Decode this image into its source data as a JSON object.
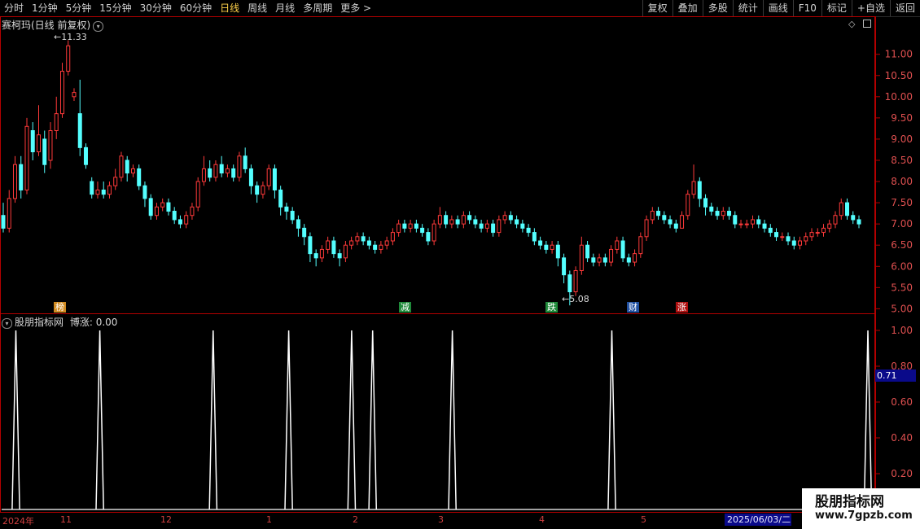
{
  "toolbar": {
    "left": [
      "分时",
      "1分钟",
      "5分钟",
      "15分钟",
      "30分钟",
      "60分钟",
      "日线",
      "周线",
      "月线",
      "多周期",
      "更多 >"
    ],
    "active_index": 6,
    "right": [
      "复权",
      "叠加",
      "多股",
      "统计",
      "画线",
      "F10",
      "标记",
      "+自选",
      "返回"
    ]
  },
  "main_panel": {
    "title": "赛柯玛(日线 前复权)",
    "high_label": "11.33",
    "low_label": "5.08",
    "markers": [
      {
        "text": "榜",
        "color": "#d08a20"
      },
      {
        "text": "减",
        "color": "#1f8a3a"
      },
      {
        "text": "跌",
        "color": "#1f8a3a"
      },
      {
        "text": "财",
        "color": "#2050a0"
      },
      {
        "text": "涨",
        "color": "#b01010"
      }
    ]
  },
  "indicator_panel": {
    "title": "股朋指标网",
    "value_label": "博涨: 0.00",
    "current_value": "0.71"
  },
  "x_axis": {
    "labels": [
      "2024年",
      "11",
      "12",
      "1",
      "2",
      "3",
      "4",
      "5"
    ],
    "current_date": "2025/06/03/二"
  },
  "watermark": {
    "line1": "股朋指标网",
    "line2": "www.7gpzb.com"
  },
  "colors": {
    "up": "#ff3a3a",
    "down": "#54ffff",
    "signal": "#ffffff",
    "axis": "#b40000"
  },
  "chart_data": {
    "type": "candlestick",
    "y_axis_main": {
      "ticks": [
        "11.00",
        "10.50",
        "10.00",
        "9.50",
        "9.00",
        "8.50",
        "8.00",
        "7.50",
        "7.00",
        "6.50",
        "6.00",
        "5.50",
        "5.00"
      ],
      "ylim": [
        4.95,
        11.8
      ]
    },
    "y_axis_indicator": {
      "ticks": [
        "1.00",
        "0.80",
        "0.60",
        "0.40",
        "0.20"
      ],
      "ylim": [
        0,
        1.05
      ]
    },
    "candles": [
      [
        7.2,
        6.9,
        7.5,
        6.8
      ],
      [
        6.9,
        7.6,
        7.8,
        6.8
      ],
      [
        7.6,
        8.4,
        8.6,
        7.5
      ],
      [
        8.4,
        7.8,
        8.6,
        7.6
      ],
      [
        7.8,
        9.3,
        9.5,
        7.7
      ],
      [
        9.2,
        8.7,
        9.4,
        8.5
      ],
      [
        8.7,
        9.1,
        9.8,
        8.6
      ],
      [
        9.0,
        8.4,
        9.2,
        8.2
      ],
      [
        8.5,
        9.2,
        9.4,
        8.3
      ],
      [
        9.2,
        9.6,
        10.0,
        9.0
      ],
      [
        9.6,
        10.6,
        10.8,
        9.5
      ],
      [
        10.6,
        11.2,
        11.33,
        10.5
      ],
      [
        10.0,
        10.1,
        10.2,
        9.9
      ],
      [
        9.6,
        8.8,
        10.4,
        8.6
      ],
      [
        8.8,
        8.4,
        8.9,
        8.3
      ],
      [
        8.0,
        7.7,
        8.1,
        7.6
      ],
      [
        7.7,
        7.8,
        8.0,
        7.6
      ],
      [
        7.8,
        7.7,
        8.0,
        7.6
      ],
      [
        7.7,
        7.9,
        8.0,
        7.6
      ],
      [
        7.9,
        8.1,
        8.3,
        7.8
      ],
      [
        8.1,
        8.6,
        8.7,
        8.0
      ],
      [
        8.5,
        8.2,
        8.6,
        8.0
      ],
      [
        8.2,
        8.3,
        8.4,
        8.1
      ],
      [
        8.3,
        7.9,
        8.4,
        7.8
      ],
      [
        7.9,
        7.6,
        8.0,
        7.4
      ],
      [
        7.6,
        7.2,
        7.7,
        7.1
      ],
      [
        7.2,
        7.4,
        7.5,
        7.1
      ],
      [
        7.4,
        7.5,
        7.6,
        7.3
      ],
      [
        7.5,
        7.3,
        7.6,
        7.2
      ],
      [
        7.3,
        7.1,
        7.4,
        7.0
      ],
      [
        7.1,
        7.0,
        7.2,
        6.9
      ],
      [
        7.0,
        7.2,
        7.3,
        6.9
      ],
      [
        7.2,
        7.4,
        7.5,
        7.1
      ],
      [
        7.4,
        8.0,
        8.1,
        7.3
      ],
      [
        8.0,
        8.3,
        8.6,
        7.9
      ],
      [
        8.3,
        8.1,
        8.5,
        8.0
      ],
      [
        8.1,
        8.4,
        8.5,
        8.0
      ],
      [
        8.4,
        8.2,
        8.6,
        8.1
      ],
      [
        8.2,
        8.3,
        8.4,
        8.1
      ],
      [
        8.3,
        8.1,
        8.4,
        8.0
      ],
      [
        8.1,
        8.6,
        8.7,
        8.0
      ],
      [
        8.6,
        8.3,
        8.8,
        8.2
      ],
      [
        8.3,
        7.9,
        8.4,
        7.7
      ],
      [
        7.9,
        7.7,
        8.0,
        7.5
      ],
      [
        7.7,
        7.9,
        8.0,
        7.6
      ],
      [
        7.9,
        8.3,
        8.4,
        7.8
      ],
      [
        8.3,
        7.8,
        8.4,
        7.6
      ],
      [
        7.8,
        7.4,
        7.9,
        7.2
      ],
      [
        7.4,
        7.3,
        7.5,
        7.1
      ],
      [
        7.3,
        7.1,
        7.4,
        7.0
      ],
      [
        7.1,
        6.9,
        7.2,
        6.7
      ],
      [
        6.9,
        6.7,
        7.0,
        6.5
      ],
      [
        6.7,
        6.3,
        6.8,
        6.1
      ],
      [
        6.3,
        6.2,
        6.4,
        6.0
      ],
      [
        6.2,
        6.4,
        6.5,
        6.1
      ],
      [
        6.4,
        6.6,
        6.7,
        6.3
      ],
      [
        6.6,
        6.3,
        6.7,
        6.2
      ],
      [
        6.3,
        6.2,
        6.4,
        6.0
      ],
      [
        6.2,
        6.5,
        6.6,
        6.1
      ],
      [
        6.5,
        6.6,
        6.7,
        6.4
      ],
      [
        6.6,
        6.7,
        6.8,
        6.5
      ],
      [
        6.7,
        6.6,
        6.8,
        6.5
      ],
      [
        6.6,
        6.5,
        6.7,
        6.4
      ],
      [
        6.5,
        6.4,
        6.6,
        6.3
      ],
      [
        6.4,
        6.5,
        6.6,
        6.3
      ],
      [
        6.5,
        6.6,
        6.7,
        6.4
      ],
      [
        6.6,
        6.8,
        6.9,
        6.5
      ],
      [
        6.8,
        7.0,
        7.1,
        6.7
      ],
      [
        7.0,
        6.9,
        7.1,
        6.8
      ],
      [
        6.9,
        7.0,
        7.1,
        6.8
      ],
      [
        7.0,
        6.9,
        7.1,
        6.8
      ],
      [
        6.9,
        6.8,
        7.0,
        6.7
      ],
      [
        6.8,
        6.6,
        6.9,
        6.5
      ],
      [
        6.6,
        7.0,
        7.1,
        6.5
      ],
      [
        7.0,
        7.2,
        7.4,
        6.9
      ],
      [
        7.2,
        7.0,
        7.3,
        6.9
      ],
      [
        7.0,
        7.1,
        7.2,
        6.9
      ],
      [
        7.1,
        7.0,
        7.2,
        6.9
      ],
      [
        7.0,
        7.2,
        7.3,
        6.9
      ],
      [
        7.2,
        7.1,
        7.3,
        7.0
      ],
      [
        7.1,
        7.0,
        7.2,
        6.9
      ],
      [
        7.0,
        6.9,
        7.1,
        6.8
      ],
      [
        6.9,
        7.0,
        7.1,
        6.8
      ],
      [
        7.0,
        6.8,
        7.1,
        6.7
      ],
      [
        6.8,
        7.1,
        7.2,
        6.7
      ],
      [
        7.1,
        7.2,
        7.3,
        7.0
      ],
      [
        7.2,
        7.1,
        7.3,
        7.0
      ],
      [
        7.1,
        7.0,
        7.2,
        6.9
      ],
      [
        7.0,
        6.9,
        7.1,
        6.8
      ],
      [
        6.9,
        6.8,
        7.0,
        6.7
      ],
      [
        6.8,
        6.6,
        6.9,
        6.5
      ],
      [
        6.6,
        6.5,
        6.7,
        6.4
      ],
      [
        6.5,
        6.4,
        6.6,
        6.3
      ],
      [
        6.4,
        6.5,
        6.6,
        6.3
      ],
      [
        6.5,
        6.2,
        6.6,
        6.0
      ],
      [
        6.2,
        5.8,
        6.3,
        5.6
      ],
      [
        5.8,
        5.4,
        5.9,
        5.08
      ],
      [
        5.4,
        5.9,
        6.0,
        5.3
      ],
      [
        5.9,
        6.5,
        6.7,
        5.8
      ],
      [
        6.5,
        6.2,
        6.6,
        6.1
      ],
      [
        6.2,
        6.1,
        6.3,
        6.0
      ],
      [
        6.1,
        6.2,
        6.3,
        6.0
      ],
      [
        6.2,
        6.1,
        6.3,
        6.0
      ],
      [
        6.1,
        6.4,
        6.5,
        6.0
      ],
      [
        6.4,
        6.6,
        6.7,
        6.3
      ],
      [
        6.6,
        6.2,
        6.7,
        6.1
      ],
      [
        6.2,
        6.1,
        6.3,
        6.0
      ],
      [
        6.1,
        6.3,
        6.4,
        6.0
      ],
      [
        6.3,
        6.7,
        6.8,
        6.2
      ],
      [
        6.7,
        7.1,
        7.2,
        6.6
      ],
      [
        7.1,
        7.3,
        7.4,
        7.0
      ],
      [
        7.3,
        7.2,
        7.4,
        7.1
      ],
      [
        7.2,
        7.1,
        7.3,
        7.0
      ],
      [
        7.1,
        7.0,
        7.2,
        6.9
      ],
      [
        7.0,
        6.9,
        7.1,
        6.8
      ],
      [
        6.9,
        7.2,
        7.3,
        6.9
      ],
      [
        7.2,
        7.7,
        7.8,
        7.1
      ],
      [
        7.7,
        8.0,
        8.4,
        7.6
      ],
      [
        8.0,
        7.6,
        8.1,
        7.4
      ],
      [
        7.6,
        7.4,
        7.7,
        7.2
      ],
      [
        7.4,
        7.3,
        7.5,
        7.2
      ],
      [
        7.3,
        7.2,
        7.4,
        7.1
      ],
      [
        7.2,
        7.3,
        7.4,
        7.1
      ],
      [
        7.3,
        7.2,
        7.4,
        7.1
      ],
      [
        7.2,
        7.0,
        7.3,
        6.9
      ],
      [
        7.0,
        7.0,
        7.1,
        6.9
      ],
      [
        7.0,
        7.0,
        7.1,
        6.9
      ],
      [
        7.0,
        7.1,
        7.2,
        6.9
      ],
      [
        7.1,
        7.0,
        7.2,
        6.9
      ],
      [
        7.0,
        6.9,
        7.1,
        6.8
      ],
      [
        6.9,
        6.8,
        7.0,
        6.7
      ],
      [
        6.8,
        6.7,
        6.9,
        6.6
      ],
      [
        6.7,
        6.7,
        6.8,
        6.6
      ],
      [
        6.7,
        6.6,
        6.8,
        6.5
      ],
      [
        6.6,
        6.5,
        6.7,
        6.4
      ],
      [
        6.5,
        6.6,
        6.7,
        6.4
      ],
      [
        6.6,
        6.7,
        6.8,
        6.5
      ],
      [
        6.7,
        6.8,
        6.9,
        6.6
      ],
      [
        6.8,
        6.8,
        6.9,
        6.7
      ],
      [
        6.8,
        6.9,
        7.0,
        6.7
      ],
      [
        6.9,
        7.0,
        7.1,
        6.8
      ],
      [
        7.0,
        7.2,
        7.3,
        6.9
      ],
      [
        7.2,
        7.5,
        7.6,
        7.1
      ],
      [
        7.5,
        7.2,
        7.6,
        7.1
      ],
      [
        7.2,
        7.1,
        7.3,
        7.0
      ],
      [
        7.1,
        7.0,
        7.2,
        6.9
      ]
    ],
    "signal_peaks": [
      3,
      23,
      50,
      68,
      83,
      88,
      107,
      145,
      206
    ],
    "signal_count": 206
  }
}
